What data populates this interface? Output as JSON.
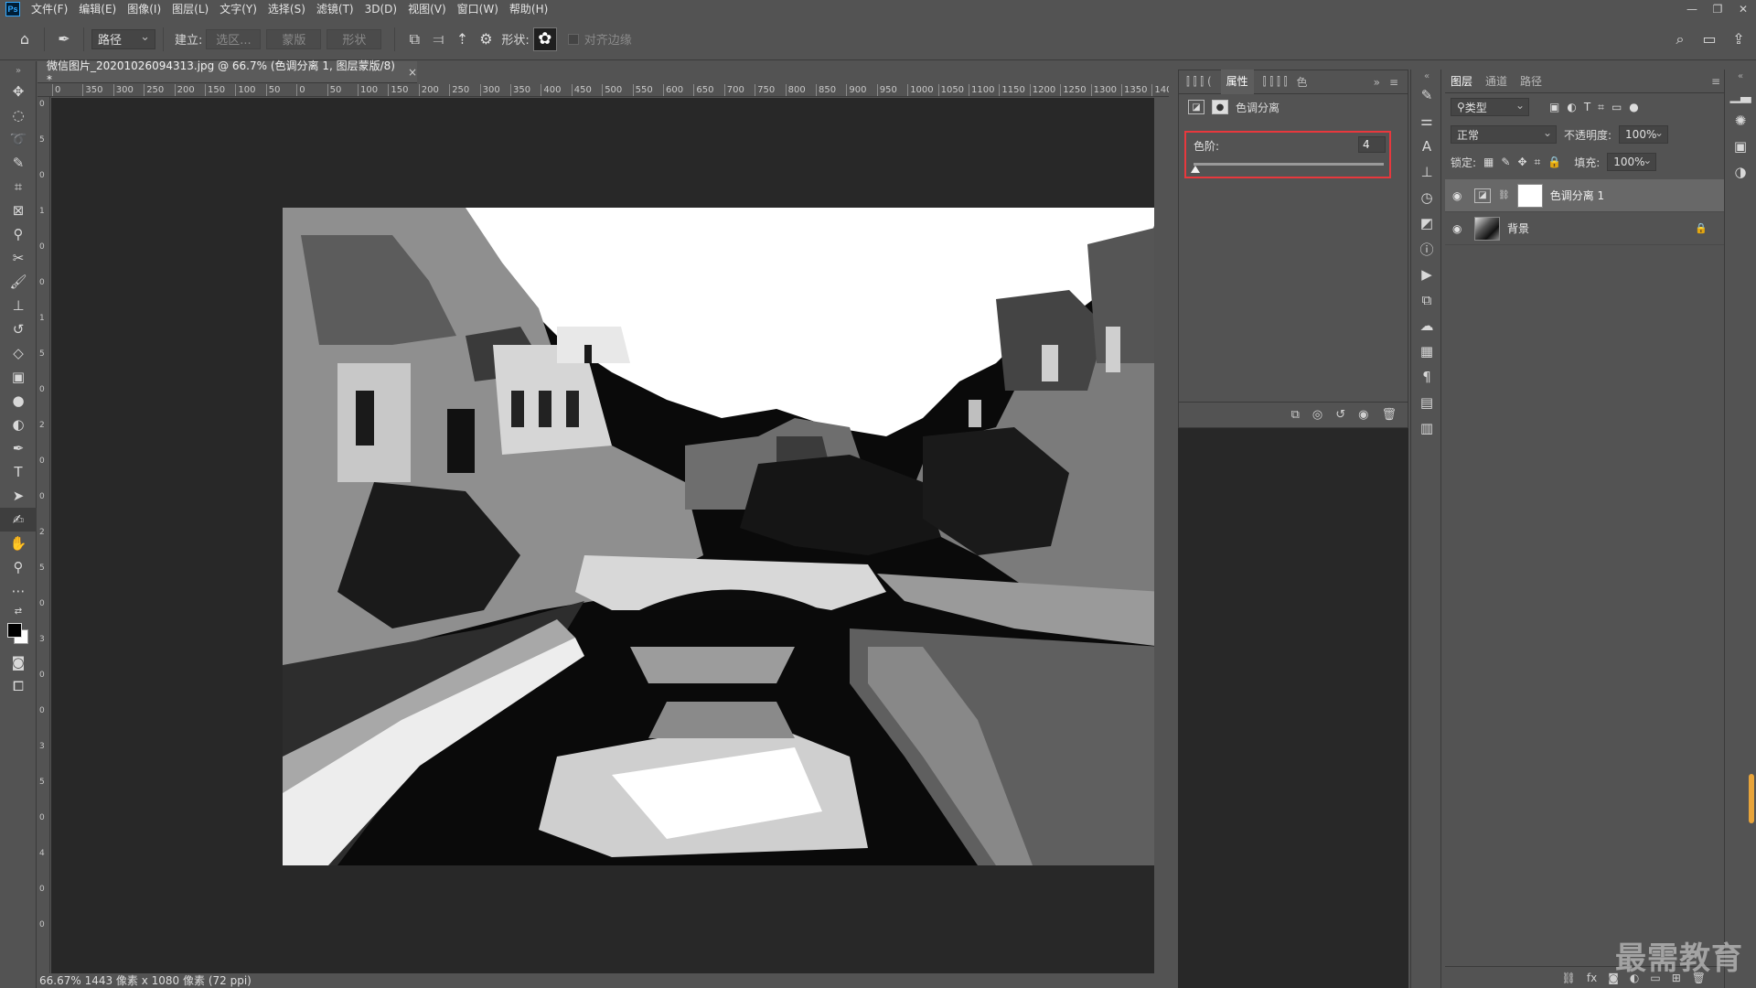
{
  "app": {
    "logo": "Ps"
  },
  "menu": [
    "文件(F)",
    "编辑(E)",
    "图像(I)",
    "图层(L)",
    "文字(Y)",
    "选择(S)",
    "滤镜(T)",
    "3D(D)",
    "视图(V)",
    "窗口(W)",
    "帮助(H)"
  ],
  "window_controls": [
    "—",
    "❐",
    "✕"
  ],
  "options_bar": {
    "mode_select": "路径",
    "create_label": "建立:",
    "btn_selection": "选区...",
    "btn_mask": "蒙版",
    "btn_shape": "形状",
    "shape_label": "形状:",
    "align_edges": "对齐边缘"
  },
  "document": {
    "tab_title": "微信图片_20201026094313.jpg @ 66.7% (色调分离 1, 图层蒙版/8) *",
    "status": "66.67%  1443 像素 x 1080 像素 (72 ppi)"
  },
  "ruler_h": [
    "0",
    "350",
    "300",
    "250",
    "200",
    "150",
    "100",
    "50",
    "0",
    "50",
    "100",
    "150",
    "200",
    "250",
    "300",
    "350",
    "400",
    "450",
    "500",
    "550",
    "600",
    "650",
    "700",
    "750",
    "800",
    "850",
    "900",
    "950",
    "1000",
    "1050",
    "1100",
    "1150",
    "1200",
    "1250",
    "1300",
    "1350",
    "1400",
    "14"
  ],
  "ruler_v": [
    "0",
    "5",
    "0",
    "1",
    "0",
    "0",
    "1",
    "5",
    "0",
    "2",
    "0",
    "0",
    "2",
    "5",
    "0",
    "3",
    "0",
    "0",
    "3",
    "5",
    "0",
    "4",
    "0",
    "0"
  ],
  "properties": {
    "tab_active": "属性",
    "tab_more": "色",
    "adjustment_name": "色调分离",
    "levels_label": "色阶:",
    "levels_value": "4",
    "levels_max": 255,
    "levels_min": 2
  },
  "layers": {
    "tabs": [
      "图层",
      "通道",
      "路径"
    ],
    "filter_kind": "类型",
    "blend_mode": "正常",
    "opacity_label": "不透明度:",
    "opacity_value": "100%",
    "lock_label": "锁定:",
    "fill_label": "填充:",
    "fill_value": "100%",
    "items": [
      {
        "name": "色调分离 1",
        "selected": true
      },
      {
        "name": "背景",
        "selected": false
      }
    ]
  },
  "watermark": "最需教育",
  "colors": {
    "highlight_border": "#e8383d"
  }
}
